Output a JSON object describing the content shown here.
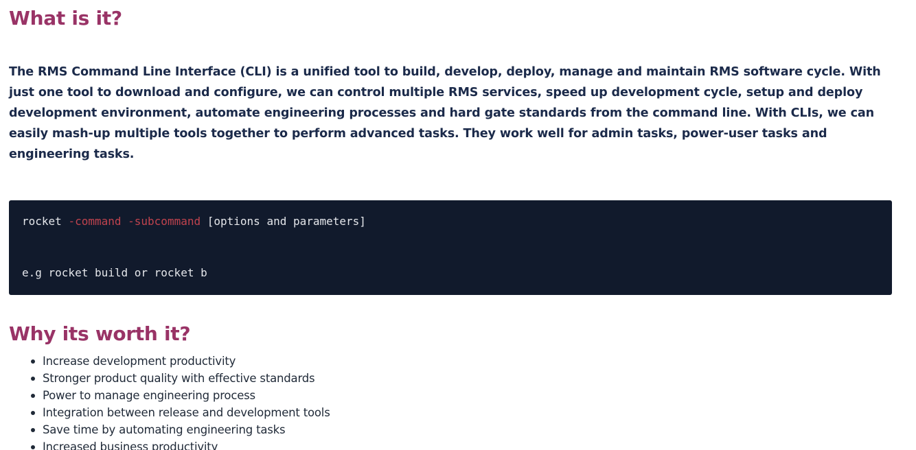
{
  "colors": {
    "heading": "#993366",
    "body_text": "#1b2a4a",
    "list_text": "#1f2937",
    "code_background": "#111a2c",
    "code_text": "#e5e7eb",
    "code_flag": "#c0434e"
  },
  "section_what": {
    "title": "What is it?",
    "description": "The RMS Command Line Interface (CLI) is a unified tool to build, develop, deploy, manage and maintain RMS software cycle. With just one tool to download and configure, we can control multiple RMS services,  speed up development cycle, setup and deploy development environment, automate engineering processes and hard gate standards from the command line. With CLIs, we can easily mash-up multiple tools together to perform advanced tasks. They work well for admin tasks, power-user tasks and engineering tasks."
  },
  "code": {
    "command": "rocket",
    "flag_command": "-command",
    "flag_subcommand": "-subcommand",
    "params": "[options and parameters]",
    "example": "e.g rocket build or rocket b"
  },
  "section_why": {
    "title": "Why its worth it?",
    "items": [
      "Increase development productivity",
      "Stronger product quality with effective standards",
      "Power to manage engineering process",
      "Integration between release and development tools",
      "Save time by automating engineering tasks",
      "Increased business productivity"
    ]
  }
}
